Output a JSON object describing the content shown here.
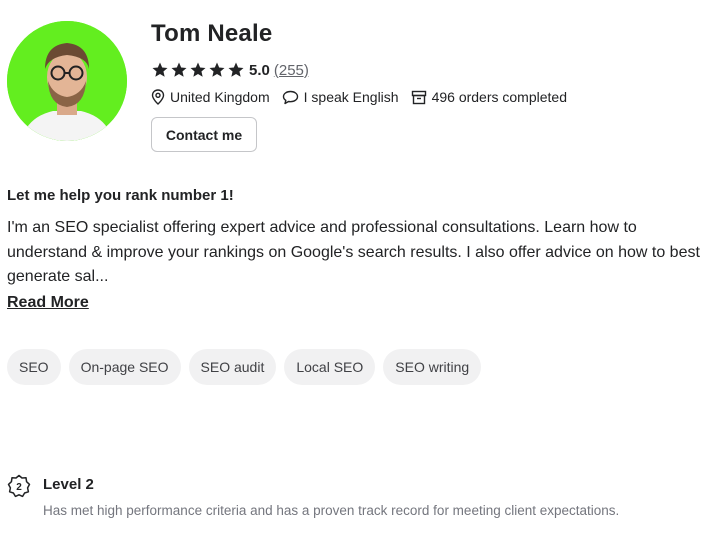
{
  "profile": {
    "name": "Tom Neale",
    "rating": "5.0",
    "rating_count": "(255)",
    "rating_fraction": 1.0,
    "location": "United Kingdom",
    "language": "I speak English",
    "orders": "496 orders completed",
    "contact_label": "Contact me",
    "avatar_bg": "#63ee1f"
  },
  "about": {
    "headline": "Let me help you rank number 1!",
    "bio": "I'm an SEO specialist offering expert advice and professional consultations. Learn how to understand & improve your rankings on Google's search results. I also offer advice on how to best generate sal...",
    "read_more": "Read More"
  },
  "skills": [
    "SEO",
    "On-page SEO",
    "SEO audit",
    "Local SEO",
    "SEO writing"
  ],
  "level": {
    "badge": "2",
    "title": "Level 2",
    "description": "Has met high performance criteria and has a proven track record for meeting client expectations."
  },
  "icons": {
    "star": "star-icon",
    "location": "location-pin-icon",
    "language": "speech-bubble-icon",
    "orders": "box-icon",
    "level": "level-badge-icon"
  }
}
